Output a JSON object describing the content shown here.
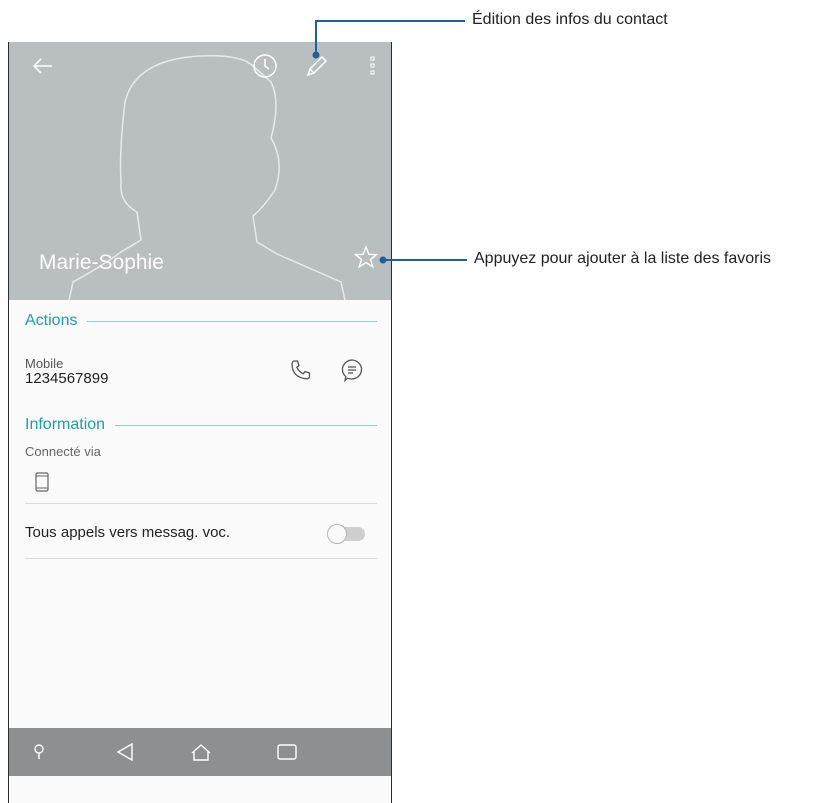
{
  "contact": {
    "name": "Marie-Sophie"
  },
  "actions": {
    "title": "Actions",
    "mobile_label": "Mobile",
    "mobile_number": "1234567899"
  },
  "information": {
    "title": "Information",
    "connected_via": "Connecté via"
  },
  "settings": {
    "voicemail_label": "Tous appels vers messag. voc.",
    "voicemail_enabled": false
  },
  "callouts": {
    "edit": "Édition des infos du contact",
    "favorite": "Appuyez pour ajouter à la liste des favoris"
  },
  "icons": {
    "header": [
      "back-arrow-icon",
      "history-icon",
      "edit-pencil-icon",
      "more-vert-icon",
      "star-outline-icon"
    ],
    "actions": [
      "phone-call-icon",
      "message-bubble-icon"
    ],
    "nav": [
      "search-icon",
      "back-triangle-icon",
      "home-icon",
      "recents-icon"
    ]
  },
  "colors": {
    "accent": "#1ba3a3",
    "header_bg": "#b9bec0",
    "navbar_bg": "#8e8f90",
    "callout_line": "#1f5f9e"
  }
}
